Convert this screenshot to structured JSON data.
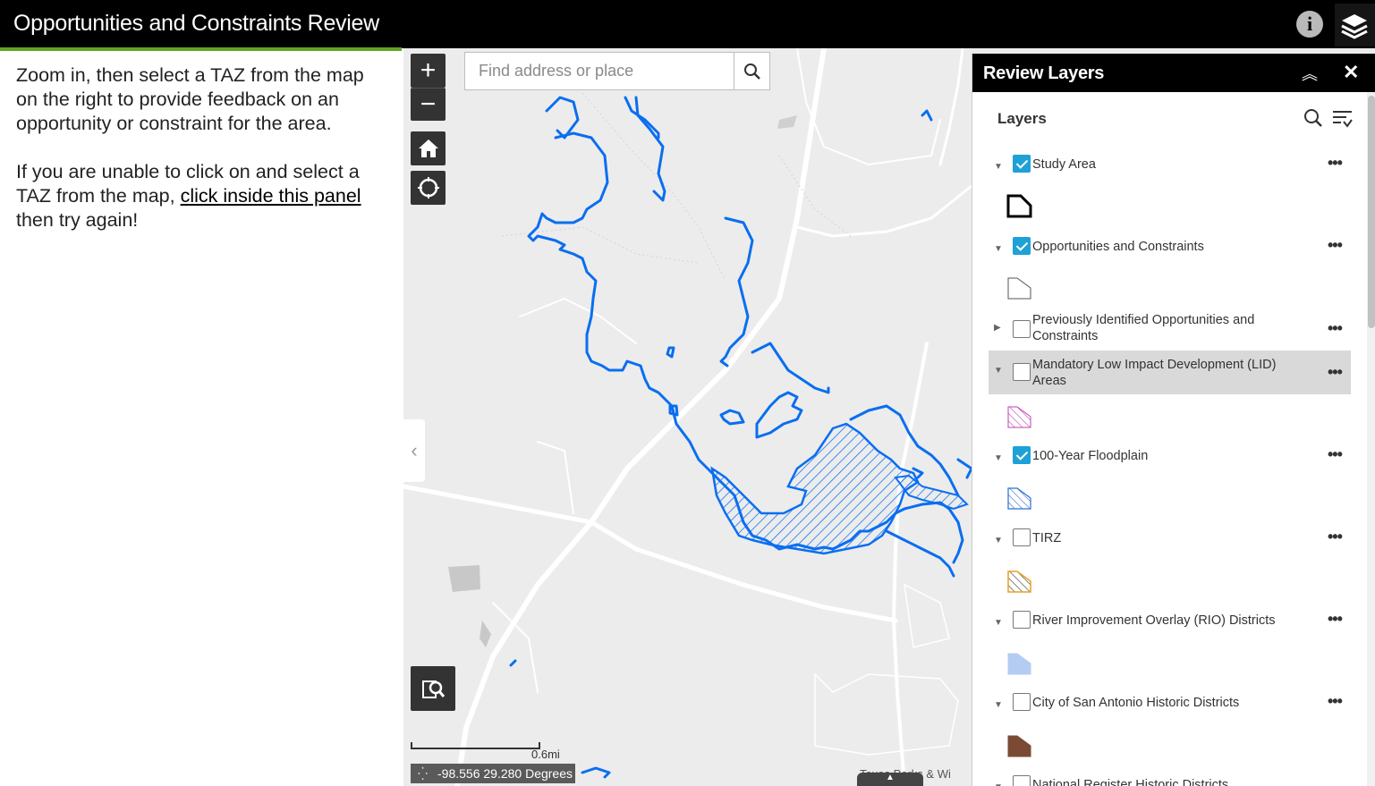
{
  "header": {
    "title": "Opportunities and Constraints Review",
    "info_icon": "info-icon",
    "layers_icon": "layers-icon"
  },
  "side_panel": {
    "paragraph1": "Zoom in, then select a TAZ from the map on the right to provide feedback on an opportunity or constraint for the area.",
    "paragraph2_before": "If you are unable to click on and select a TAZ from the map, ",
    "paragraph2_link": "click inside this panel",
    "paragraph2_after": " then try again!"
  },
  "map": {
    "search_placeholder": "Find address or place",
    "zoom_in": "+",
    "zoom_out": "−",
    "scale_label": "0.6mi",
    "coordinates": "-98.556 29.280 Degrees",
    "attribution": "Texas Parks & Wi",
    "colors": {
      "water": "#0a6ef0",
      "land": "#ececec",
      "road": "#ffffff"
    }
  },
  "layer_panel": {
    "title": "Review Layers",
    "subtitle": "Layers",
    "layers": [
      {
        "name": "Study Area",
        "checked": true,
        "expanded": true
      },
      {
        "name": "Opportunities and Constraints",
        "checked": true,
        "expanded": true
      },
      {
        "name": "Previously Identified Opportunities and Constraints",
        "checked": false,
        "expanded": false
      },
      {
        "name": "Mandatory Low Impact Development (LID) Areas",
        "checked": false,
        "expanded": true,
        "highlighted": true
      },
      {
        "name": "100-Year Floodplain",
        "checked": true,
        "expanded": true
      },
      {
        "name": "TIRZ",
        "checked": false,
        "expanded": true
      },
      {
        "name": "River Improvement Overlay (RIO) Districts",
        "checked": false,
        "expanded": true
      },
      {
        "name": "City of San Antonio Historic Districts",
        "checked": false,
        "expanded": true
      },
      {
        "name": "National Register Historic Districts",
        "checked": false,
        "expanded": true
      }
    ],
    "more_label": "•••"
  }
}
